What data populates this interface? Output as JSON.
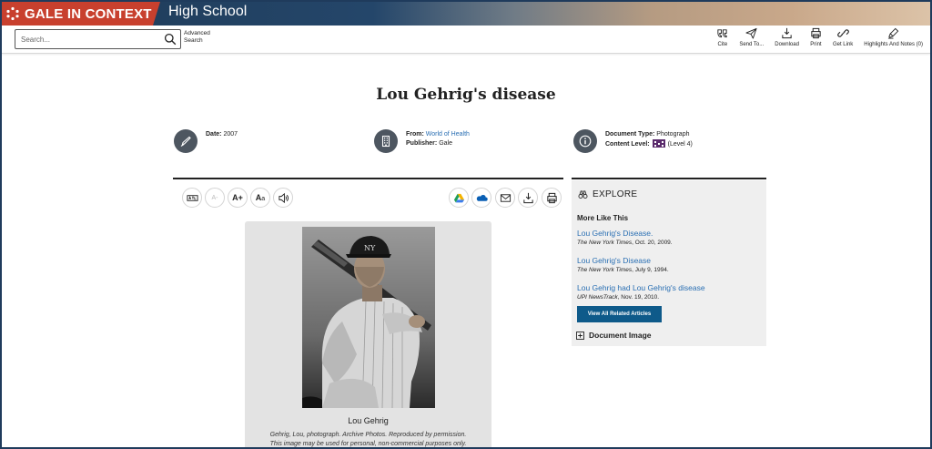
{
  "header": {
    "brand": "GALE IN CONTEXT",
    "product": "High School"
  },
  "search": {
    "placeholder": "Search...",
    "advanced": "Advanced Search"
  },
  "tools": [
    {
      "label": "Cite",
      "icon": "quote-icon"
    },
    {
      "label": "Send To...",
      "icon": "send-icon"
    },
    {
      "label": "Download",
      "icon": "download-icon"
    },
    {
      "label": "Print",
      "icon": "print-icon"
    },
    {
      "label": "Get Link",
      "icon": "link-icon"
    },
    {
      "label": "Highlights And Notes (0)",
      "icon": "highlighter-icon"
    }
  ],
  "document": {
    "title": "Lou Gehrig's disease",
    "date_label": "Date:",
    "date": "2007",
    "from_label": "From:",
    "from": "World of Health",
    "publisher_label": "Publisher:",
    "publisher": "Gale",
    "type_label": "Document Type:",
    "type": "Photograph",
    "level_label": "Content Level:",
    "level": "(Level 4)"
  },
  "image": {
    "caption": "Lou Gehrig",
    "credit_line1": "Gehrig, Lou, photograph. Archive Photos. Reproduced by permission.",
    "credit_line2": "This image may be used for personal, non-commercial purposes only."
  },
  "explore": {
    "heading": "EXPLORE",
    "more_like_this": "More Like This",
    "related": [
      {
        "title": "Lou Gehrig's Disease.",
        "source": "The New York Times",
        "date": ", Oct. 20, 2009."
      },
      {
        "title": "Lou Gehrig's Disease",
        "source": "The New York Times",
        "date": ", July 9, 1994."
      },
      {
        "title": "Lou Gehrig had Lou Gehrig's disease",
        "source": "UPI NewsTrack",
        "date": ", Nov. 19, 2010."
      }
    ],
    "view_all": "View All Related Articles",
    "document_image": "Document Image"
  },
  "colors": {
    "brand_red": "#c8402e",
    "header_navy": "#1f3a56",
    "link_blue": "#2a6fb3",
    "button_blue": "#0e5a8a",
    "level_purple": "#5a2a6b"
  }
}
